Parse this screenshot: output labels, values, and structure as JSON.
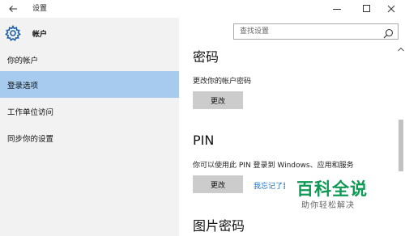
{
  "window": {
    "title": "设置"
  },
  "sidebar": {
    "header_label": "帐户",
    "items": [
      {
        "label": "你的帐户"
      },
      {
        "label": "登录选项"
      },
      {
        "label": "工作单位访问"
      },
      {
        "label": "同步你的设置"
      }
    ],
    "selected_index": 1,
    "selected_color": "#a6cbef"
  },
  "search": {
    "placeholder": "查找设置"
  },
  "main": {
    "password": {
      "title": "密码",
      "description": "更改你的帐户密码",
      "button_label": "更改"
    },
    "pin": {
      "title": "PIN",
      "description": "你可以使用此 PIN 登录到 Windows、应用和服务",
      "button_label": "更改",
      "link_label": "我忘记了我的 PIN"
    },
    "picture_password": {
      "title": "图片密码"
    }
  },
  "watermark": {
    "text": "百科全说",
    "subtext": "助你轻松解决",
    "color": "#0d9a54"
  },
  "colors": {
    "link": "#1a6fc4",
    "button_bg": "#cccccc",
    "sidebar_bg": "#f2f2f2"
  },
  "icons": {
    "back": "back-arrow-icon",
    "minimize": "minimize-icon",
    "maximize": "maximize-icon",
    "close": "close-icon",
    "settings": "gear-icon",
    "search": "search-icon",
    "scroll_up": "chevron-up-icon"
  }
}
